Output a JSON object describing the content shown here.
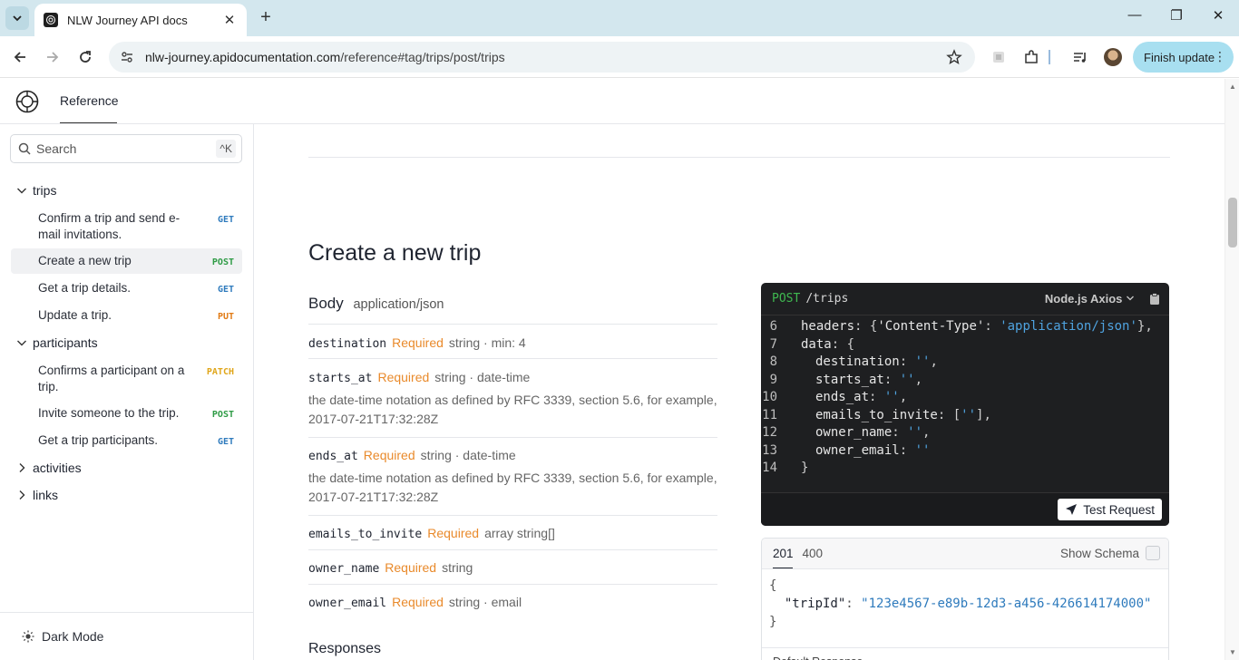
{
  "browser": {
    "tab_title": "NLW Journey API docs",
    "url_host": "nlw-journey.apidocumentation.com",
    "url_path": "/reference#tag/trips/post/trips",
    "finish_update_label": "Finish update"
  },
  "header": {
    "reference_tab": "Reference"
  },
  "sidebar": {
    "search_placeholder": "Search",
    "search_shortcut": "^K",
    "groups": [
      {
        "label": "trips",
        "expanded": true
      },
      {
        "label": "participants",
        "expanded": true
      },
      {
        "label": "activities",
        "expanded": false
      },
      {
        "label": "links",
        "expanded": false
      }
    ],
    "items": [
      {
        "label": "Confirm a trip and send e-mail invitations.",
        "method": "GET"
      },
      {
        "label": "Create a new trip",
        "method": "POST"
      },
      {
        "label": "Get a trip details.",
        "method": "GET"
      },
      {
        "label": "Update a trip.",
        "method": "PUT"
      },
      {
        "label": "Confirms a participant on a trip.",
        "method": "PATCH"
      },
      {
        "label": "Invite someone to the trip.",
        "method": "POST"
      },
      {
        "label": "Get a trip participants.",
        "method": "GET"
      }
    ],
    "dark_mode_label": "Dark Mode"
  },
  "main": {
    "title": "Create a new trip",
    "body_label": "Body",
    "content_type": "application/json",
    "params": [
      {
        "name": "destination",
        "required": "Required",
        "type": "string · min: 4",
        "desc": ""
      },
      {
        "name": "starts_at",
        "required": "Required",
        "type": "string · date-time",
        "desc": "the date-time notation as defined by RFC 3339, section 5.6, for example, 2017-07-21T17:32:28Z"
      },
      {
        "name": "ends_at",
        "required": "Required",
        "type": "string · date-time",
        "desc": "the date-time notation as defined by RFC 3339, section 5.6, for example, 2017-07-21T17:32:28Z"
      },
      {
        "name": "emails_to_invite",
        "required": "Required",
        "type": "array string[]",
        "desc": ""
      },
      {
        "name": "owner_name",
        "required": "Required",
        "type": "string",
        "desc": ""
      },
      {
        "name": "owner_email",
        "required": "Required",
        "type": "string · email",
        "desc": ""
      }
    ],
    "responses_label": "Responses"
  },
  "code_sample": {
    "method": "POST",
    "path": "/trips",
    "language": "Node.js Axios",
    "lines": [
      {
        "n": "6",
        "indent": 1,
        "parts": [
          [
            "k",
            "headers"
          ],
          [
            "pn",
            ": {"
          ],
          [
            "k",
            "'Content-Type'"
          ],
          [
            "pn",
            ": "
          ],
          [
            "s",
            "'application/json'"
          ],
          [
            "pn",
            "},"
          ]
        ]
      },
      {
        "n": "7",
        "indent": 1,
        "parts": [
          [
            "k",
            "data"
          ],
          [
            "pn",
            ": {"
          ]
        ]
      },
      {
        "n": "8",
        "indent": 2,
        "parts": [
          [
            "k",
            "destination"
          ],
          [
            "pn",
            ": "
          ],
          [
            "s",
            "''"
          ],
          [
            "pn",
            ","
          ]
        ]
      },
      {
        "n": "9",
        "indent": 2,
        "parts": [
          [
            "k",
            "starts_at"
          ],
          [
            "pn",
            ": "
          ],
          [
            "s",
            "''"
          ],
          [
            "pn",
            ","
          ]
        ]
      },
      {
        "n": "10",
        "indent": 2,
        "parts": [
          [
            "k",
            "ends_at"
          ],
          [
            "pn",
            ": "
          ],
          [
            "s",
            "''"
          ],
          [
            "pn",
            ","
          ]
        ]
      },
      {
        "n": "11",
        "indent": 2,
        "parts": [
          [
            "k",
            "emails_to_invite"
          ],
          [
            "pn",
            ": ["
          ],
          [
            "s",
            "''"
          ],
          [
            "pn",
            "],"
          ]
        ]
      },
      {
        "n": "12",
        "indent": 2,
        "parts": [
          [
            "k",
            "owner_name"
          ],
          [
            "pn",
            ": "
          ],
          [
            "s",
            "''"
          ],
          [
            "pn",
            ","
          ]
        ]
      },
      {
        "n": "13",
        "indent": 2,
        "parts": [
          [
            "k",
            "owner_email"
          ],
          [
            "pn",
            ": "
          ],
          [
            "s",
            "''"
          ]
        ]
      },
      {
        "n": "14",
        "indent": 1,
        "parts": [
          [
            "pn",
            "}"
          ]
        ]
      }
    ],
    "test_button": "Test Request"
  },
  "response_sample": {
    "tabs": [
      "201",
      "400"
    ],
    "show_schema_label": "Show Schema",
    "open_brace": "{",
    "key": "\"tripId\"",
    "value": "\"123e4567-e89b-12d3-a456-426614174000\"",
    "close_brace": "}",
    "footer": "Default Response"
  }
}
